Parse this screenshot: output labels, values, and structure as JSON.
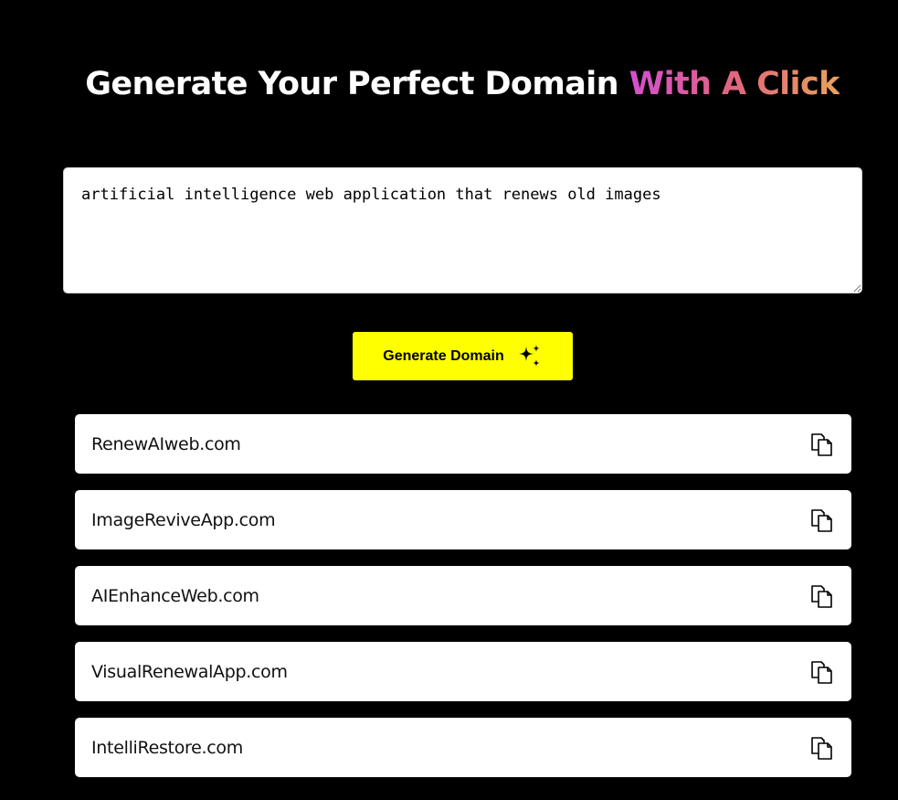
{
  "header": {
    "title_main": "Generate Your Perfect Domain ",
    "title_accent": "With A Click"
  },
  "prompt": {
    "value": "artificial intelligence web application that renews old images"
  },
  "generate_button": {
    "label": "Generate Domain",
    "icon": "sparkles-icon",
    "color": "#ffff00"
  },
  "results": [
    {
      "domain": "RenewAIweb.com",
      "icon": "copy-icon"
    },
    {
      "domain": "ImageReviveApp.com",
      "icon": "copy-icon"
    },
    {
      "domain": "AIEnhanceWeb.com",
      "icon": "copy-icon"
    },
    {
      "domain": "VisualRenewalApp.com",
      "icon": "copy-icon"
    },
    {
      "domain": "IntelliRestore.com",
      "icon": "copy-icon"
    }
  ],
  "colors": {
    "background": "#000000",
    "accent_gradient_start": "#d34fcf",
    "accent_gradient_end": "#e8a35a"
  }
}
